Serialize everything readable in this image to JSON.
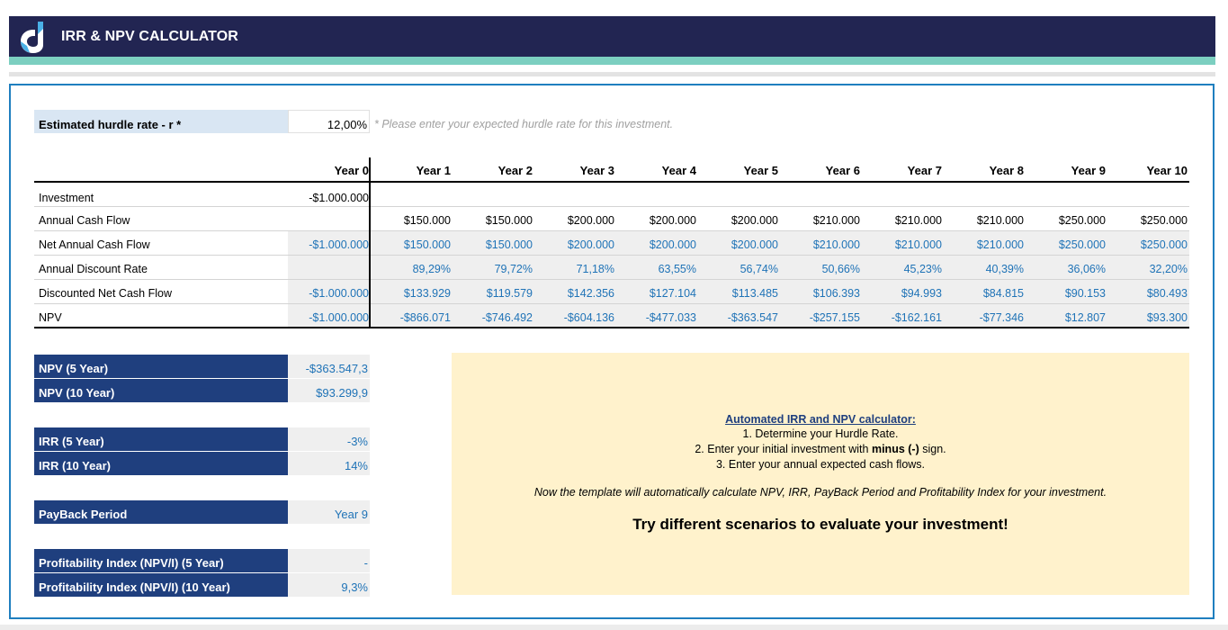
{
  "header": {
    "title": "IRR & NPV CALCULATOR"
  },
  "hurdle": {
    "label": "Estimated hurdle rate - r *",
    "value": "12,00%",
    "note": "* Please enter your expected hurdle rate for this investment."
  },
  "table": {
    "years": [
      "Year 0",
      "Year 1",
      "Year 2",
      "Year 3",
      "Year 4",
      "Year 5",
      "Year 6",
      "Year 7",
      "Year 8",
      "Year 9",
      "Year 10"
    ],
    "rows": [
      {
        "label": "Investment",
        "values": [
          "-$1.000.000",
          "",
          "",
          "",
          "",
          "",
          "",
          "",
          "",
          "",
          ""
        ]
      },
      {
        "label": "Annual Cash Flow",
        "values": [
          "",
          "$150.000",
          "$150.000",
          "$200.000",
          "$200.000",
          "$200.000",
          "$210.000",
          "$210.000",
          "$210.000",
          "$250.000",
          "$250.000"
        ]
      },
      {
        "label": "Net Annual Cash Flow",
        "values": [
          "-$1.000.000",
          "$150.000",
          "$150.000",
          "$200.000",
          "$200.000",
          "$200.000",
          "$210.000",
          "$210.000",
          "$210.000",
          "$250.000",
          "$250.000"
        ]
      },
      {
        "label": "Annual Discount Rate",
        "values": [
          "",
          "89,29%",
          "79,72%",
          "71,18%",
          "63,55%",
          "56,74%",
          "50,66%",
          "45,23%",
          "40,39%",
          "36,06%",
          "32,20%"
        ]
      },
      {
        "label": "Discounted Net Cash Flow",
        "values": [
          "-$1.000.000",
          "$133.929",
          "$119.579",
          "$142.356",
          "$127.104",
          "$113.485",
          "$106.393",
          "$94.993",
          "$84.815",
          "$90.153",
          "$80.493"
        ]
      },
      {
        "label": "NPV",
        "values": [
          "-$1.000.000",
          "-$866.071",
          "-$746.492",
          "-$604.136",
          "-$477.033",
          "-$363.547",
          "-$257.155",
          "-$162.161",
          "-$77.346",
          "$12.807",
          "$93.300"
        ]
      }
    ]
  },
  "summary": {
    "npv5_label": "NPV (5 Year)",
    "npv5_value": "-$363.547,3",
    "npv10_label": "NPV (10 Year)",
    "npv10_value": "$93.299,9",
    "irr5_label": "IRR (5 Year)",
    "irr5_value": "-3%",
    "irr10_label": "IRR (10 Year)",
    "irr10_value": "14%",
    "payback_label": "PayBack Period",
    "payback_value": "Year 9",
    "pi5_label": "Profitability Index (NPV/I) (5 Year)",
    "pi5_value": "-",
    "pi10_label": "Profitability Index (NPV/I) (10 Year)",
    "pi10_value": "9,3%"
  },
  "info": {
    "title": "Automated IRR and NPV calculator:",
    "step1": "1. Determine your Hurdle Rate.",
    "step2_pre": "2. Enter your initial investment with ",
    "step2_bold": "minus (-)",
    "step2_post": " sign.",
    "step3": "3. Enter your annual expected cash flows.",
    "note": "Now the template will automatically calculate NPV, IRR, PayBack Period and Profitability Index for your investment.",
    "cta": "Try different scenarios to evaluate your investment!"
  },
  "colors": {
    "header": "#222552",
    "accent": "#7ccfc0",
    "label_blue": "#1f3f7e",
    "value_blue": "#1f73b7",
    "info_bg": "#fff2cc"
  }
}
